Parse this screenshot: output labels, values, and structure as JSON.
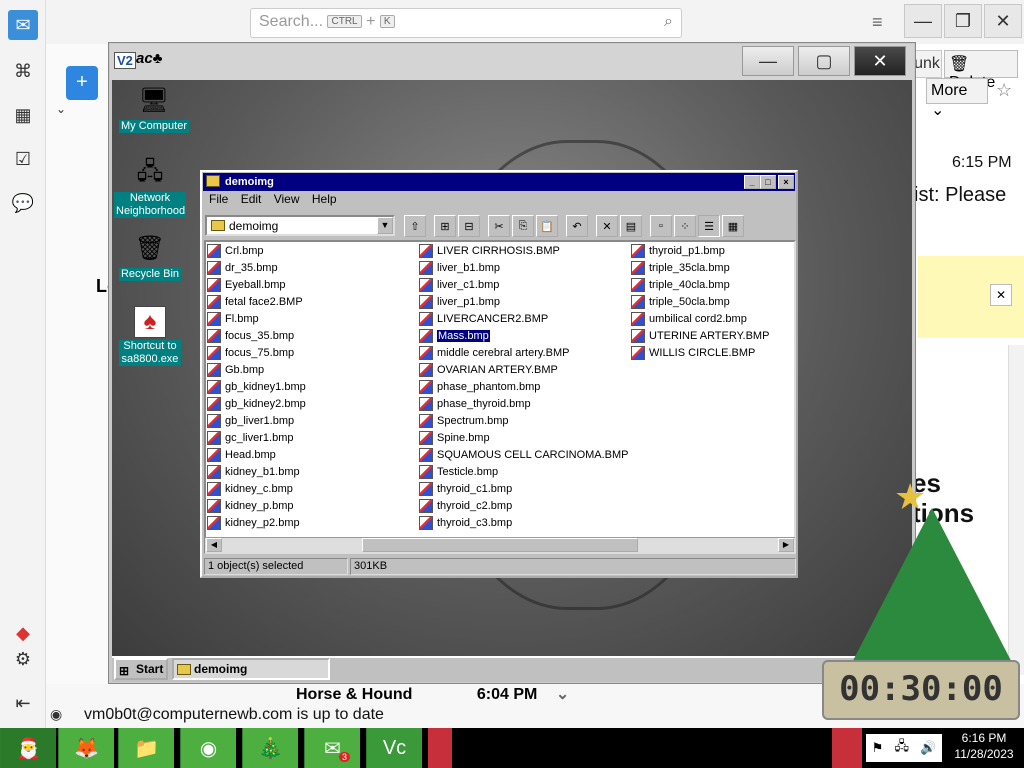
{
  "host": {
    "search": {
      "placeholder": "Search...",
      "kbd1": "CTRL",
      "plus": "+",
      "kbd2": "K"
    },
    "buttons": {
      "junk": "unk",
      "delete": "Delete",
      "more": "More"
    },
    "message": {
      "time": "6:15 PM",
      "subject_fragment": "ist: Please"
    },
    "bottom_row": {
      "sender": "Horse & Hound",
      "time": "6:04 PM"
    },
    "status": "vm0b0t@computernewb.com is up to date",
    "promo_fragment_1": "es",
    "promo_fragment_2": "tions",
    "folder_fragment": "Lo"
  },
  "taskbar": {
    "clock_time": "6:16 PM",
    "clock_date": "11/28/2023",
    "badge": "3",
    "items": [
      "santa",
      "firefox",
      "file-explorer",
      "chrome",
      "xmas-tree",
      "thunderbird",
      "vnc"
    ]
  },
  "vm_desktop": {
    "icons": [
      {
        "label": "My Computer"
      },
      {
        "label": "Network Neighborhood"
      },
      {
        "label": "Recycle Bin"
      },
      {
        "label": "Shortcut to sa8800.exe"
      }
    ],
    "taskbar": {
      "start": "Start",
      "task": "demoimg"
    },
    "counter": "00:30:00"
  },
  "explorer": {
    "title": "demoimg",
    "menu": [
      "File",
      "Edit",
      "View",
      "Help"
    ],
    "address": "demoimg",
    "files_col1": [
      "Crl.bmp",
      "dr_35.bmp",
      "Eyeball.bmp",
      "fetal face2.BMP",
      "Fl.bmp",
      "focus_35.bmp",
      "focus_75.bmp",
      "Gb.bmp",
      "gb_kidney1.bmp",
      "gb_kidney2.bmp",
      "gb_liver1.bmp",
      "gc_liver1.bmp",
      "Head.bmp",
      "kidney_b1.bmp",
      "kidney_c.bmp",
      "kidney_p.bmp",
      "kidney_p2.bmp"
    ],
    "files_col2": [
      "LIVER CIRRHOSIS.BMP",
      "liver_b1.bmp",
      "liver_c1.bmp",
      "liver_p1.bmp",
      "LIVERCANCER2.BMP",
      "Mass.bmp",
      "middle cerebral artery.BMP",
      "OVARIAN ARTERY.BMP",
      "phase_phantom.bmp",
      "phase_thyroid.bmp",
      "Spectrum.bmp",
      "Spine.bmp",
      "SQUAMOUS CELL CARCINOMA.BMP",
      "Testicle.bmp",
      "thyroid_c1.bmp",
      "thyroid_c2.bmp",
      "thyroid_c3.bmp"
    ],
    "files_col3": [
      "thyroid_p1.bmp",
      "triple_35cla.bmp",
      "triple_40cla.bmp",
      "triple_50cla.bmp",
      "umbilical cord2.bmp",
      "UTERINE ARTERY.BMP",
      "WILLIS CIRCLE.BMP"
    ],
    "selected": "Mass.bmp",
    "status_left": "1 object(s) selected",
    "status_right": "301KB"
  },
  "icons": {
    "host_sidebar": [
      "mail-icon",
      "address-book-icon",
      "calendar-icon",
      "tasks-icon",
      "chat-icon",
      "settings-icon",
      "collapse-icon"
    ]
  }
}
